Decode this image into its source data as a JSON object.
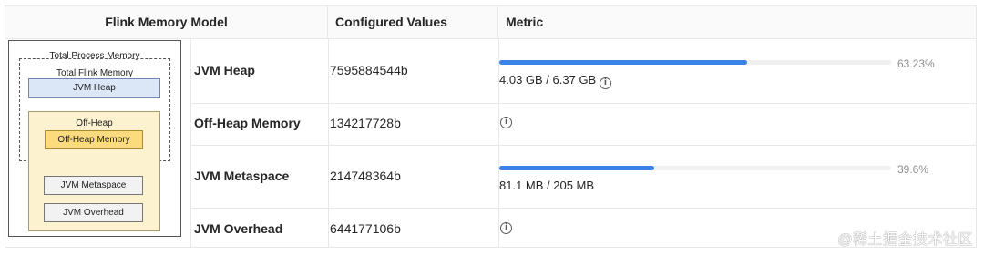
{
  "header": {
    "col1": "Flink Memory Model",
    "col2": "Configured Values",
    "col3": "Metric"
  },
  "diagram": {
    "total_process": "Total Process Memory",
    "total_flink": "Total Flink Memory",
    "jvm_heap": "JVM Heap",
    "off_heap": "Off-Heap",
    "off_heap_memory": "Off-Heap Memory",
    "jvm_metaspace": "JVM Metaspace",
    "jvm_overhead": "JVM Overhead"
  },
  "rows": [
    {
      "name": "JVM Heap",
      "value": "7595884544b",
      "metric_percent": 63.23,
      "percent_label": "63.23%",
      "usage": "4.03 GB / 6.37 GB",
      "has_info": true
    },
    {
      "name": "Off-Heap Memory",
      "value": "134217728b",
      "has_info": true
    },
    {
      "name": "JVM Metaspace",
      "value": "214748364b",
      "metric_percent": 39.6,
      "percent_label": "39.6%",
      "usage": "81.1 MB / 205 MB",
      "has_info": false
    },
    {
      "name": "JVM Overhead",
      "value": "644177106b",
      "has_info": true
    }
  ],
  "info_glyph": "i",
  "watermark": "@稀土掘金技术社区",
  "colors": {
    "bar_fill": "#3a82e6",
    "bar_track": "#f0f0f0",
    "heap_box": "#dbe6f6",
    "offheap_box": "#fdf2cf",
    "offheap_memory_box": "#fbdb7d"
  }
}
